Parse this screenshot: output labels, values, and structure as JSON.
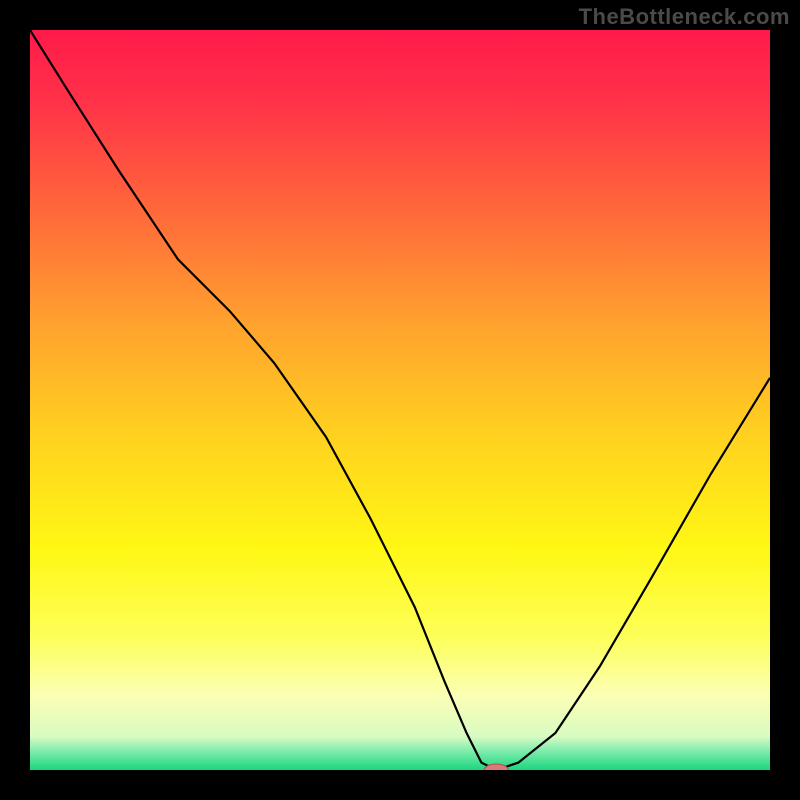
{
  "watermark": "TheBottleneck.com",
  "chart_data": {
    "type": "line",
    "title": "",
    "xlabel": "",
    "ylabel": "",
    "xlim": [
      0,
      100
    ],
    "ylim": [
      0,
      100
    ],
    "grid": false,
    "background": {
      "type": "vertical-gradient",
      "stops": [
        {
          "offset": 0.0,
          "color": "#ff1a4b"
        },
        {
          "offset": 0.1,
          "color": "#ff3348"
        },
        {
          "offset": 0.25,
          "color": "#ff6a3a"
        },
        {
          "offset": 0.4,
          "color": "#ffa32e"
        },
        {
          "offset": 0.55,
          "color": "#ffd21f"
        },
        {
          "offset": 0.7,
          "color": "#fff714"
        },
        {
          "offset": 0.82,
          "color": "#fdff59"
        },
        {
          "offset": 0.9,
          "color": "#fbffb5"
        },
        {
          "offset": 0.955,
          "color": "#d8fbc2"
        },
        {
          "offset": 0.975,
          "color": "#7cecab"
        },
        {
          "offset": 1.0,
          "color": "#1bd67f"
        }
      ]
    },
    "series": [
      {
        "name": "bottleneck-curve",
        "color": "#000000",
        "width": 2.2,
        "x": [
          0,
          5,
          12,
          20,
          27,
          33,
          40,
          46,
          52,
          56,
          59,
          61,
          63,
          66,
          71,
          77,
          84,
          92,
          100
        ],
        "y": [
          100,
          92,
          81,
          69,
          62,
          55,
          45,
          34,
          22,
          12,
          5,
          1,
          0,
          1,
          5,
          14,
          26,
          40,
          53
        ]
      }
    ],
    "marker": {
      "name": "optimal-point",
      "x": 63,
      "y": 0,
      "rx": 12,
      "ry": 6,
      "fill": "#d87a7a",
      "stroke": "#b05050"
    }
  }
}
